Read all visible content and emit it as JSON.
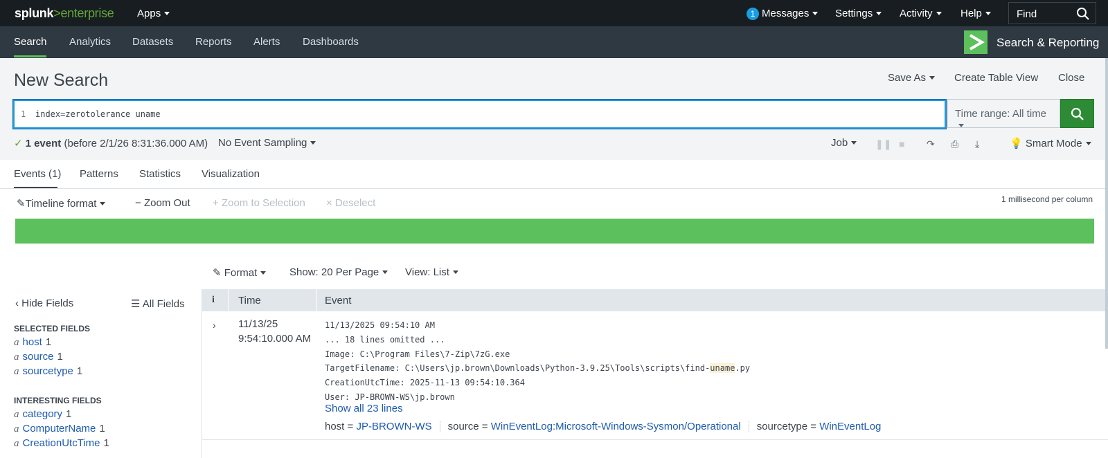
{
  "topbar": {
    "logo_a": "splunk",
    "logo_gt": ">",
    "logo_b": "enterprise",
    "apps": "Apps",
    "messages_count": "1",
    "messages": "Messages",
    "settings": "Settings",
    "activity": "Activity",
    "help": "Help",
    "find": "Find"
  },
  "appnav": {
    "items": [
      "Search",
      "Analytics",
      "Datasets",
      "Reports",
      "Alerts",
      "Dashboards"
    ],
    "app_title": "Search & Reporting"
  },
  "search": {
    "title": "New Search",
    "save_as": "Save As",
    "create_table_view": "Create Table View",
    "close": "Close",
    "line_number": "1",
    "query": "index=zerotolerance uname",
    "time_range": "Time range: All time",
    "status_count": "1 event",
    "status_detail": "(before 2/1/26 8:31:36.000 AM)",
    "sampling": "No Event Sampling",
    "job": "Job",
    "mode": "Smart Mode"
  },
  "tabs": [
    "Events (1)",
    "Patterns",
    "Statistics",
    "Visualization"
  ],
  "timeline": {
    "format": "Timeline format",
    "zoom_out": "Zoom Out",
    "zoom_selection": "Zoom to Selection",
    "deselect": "Deselect",
    "scale": "1 millisecond per column"
  },
  "results_controls": {
    "format": "Format",
    "show": "Show: 20 Per Page",
    "view": "View: List"
  },
  "sidebar": {
    "hide_fields": "Hide Fields",
    "all_fields": "All Fields",
    "selected_header": "SELECTED FIELDS",
    "selected": [
      {
        "type": "a",
        "name": "host",
        "count": "1"
      },
      {
        "type": "a",
        "name": "source",
        "count": "1"
      },
      {
        "type": "a",
        "name": "sourcetype",
        "count": "1"
      }
    ],
    "interesting_header": "INTERESTING FIELDS",
    "interesting": [
      {
        "type": "a",
        "name": "category",
        "count": "1"
      },
      {
        "type": "a",
        "name": "ComputerName",
        "count": "1"
      },
      {
        "type": "a",
        "name": "CreationUtcTime",
        "count": "1"
      }
    ]
  },
  "events_table": {
    "columns": [
      "i",
      "Time",
      "Event"
    ],
    "row": {
      "date": "11/13/25",
      "time": "9:54:10.000 AM",
      "line1": "11/13/2025 09:54:10 AM",
      "line2": "... 18 lines omitted ...",
      "line3": "Image: C:\\Program Files\\7-Zip\\7zG.exe",
      "line4_pre": "TargetFilename: C:\\Users\\jp.brown\\Downloads\\Python-3.9.25\\Tools\\scripts\\find-",
      "line4_hl": "uname",
      "line4_post": ".py",
      "line5": "CreationUtcTime: 2025-11-13 09:54:10.364",
      "line6": "User: JP-BROWN-WS\\jp.brown",
      "show_all": "Show all 23 lines",
      "host_label": "host =",
      "host": "JP-BROWN-WS",
      "source_label": "source =",
      "source": "WinEventLog:Microsoft-Windows-Sysmon/Operational",
      "sourcetype_label": "sourcetype =",
      "sourcetype": "WinEventLog"
    }
  },
  "colors": {
    "accent_green": "#5cc05c",
    "topbar": "#171d21",
    "appnav": "#2f3942",
    "link": "#1e5bb0"
  }
}
